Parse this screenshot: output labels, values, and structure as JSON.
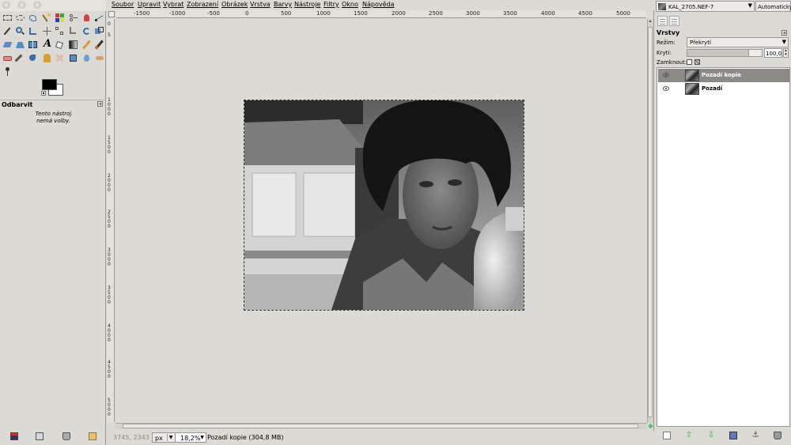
{
  "toolbox": {
    "tool_options_title": "Odbarvit",
    "tool_options_note": "Tento nástroj\nnemá volby.",
    "foreground_color": "#000000",
    "background_color": "#ffffff"
  },
  "menu": {
    "items": [
      "Soubor",
      "Upravit",
      "Vybrat",
      "Zobrazení",
      "Obrázek",
      "Vrstva",
      "Barvy",
      "Nástroje",
      "Filtry",
      "Okno",
      "Nápověda"
    ]
  },
  "ruler": {
    "h_labels": [
      "-1500",
      "-1000",
      "-500",
      "0",
      "500",
      "1000",
      "1500",
      "2000",
      "2500",
      "3000",
      "3500",
      "4000",
      "4500",
      "5000"
    ],
    "v_labels": [
      "0",
      "5",
      "1000",
      "1500",
      "2000",
      "2500",
      "3000",
      "3500",
      "4000",
      "4500",
      "5000"
    ]
  },
  "status": {
    "pointer_coords": "3745, 2343",
    "unit": "px",
    "zoom": "18,2%",
    "text": "Pozadí kopie (304,8 MB)"
  },
  "dock": {
    "image_name": "KAL_2705.NEF-7",
    "auto_label": "Automaticky",
    "layers_title": "Vrstvy",
    "mode_label": "Režim:",
    "mode_value": "Překrytí",
    "opacity_label": "Krytí:",
    "opacity_value": "100,0",
    "lock_label": "Zamknout:",
    "layers": [
      {
        "name": "Pozadí kopie",
        "selected": true
      },
      {
        "name": "Pozadí",
        "selected": false
      }
    ]
  },
  "colors": {
    "window_bg": "#dcdad5",
    "selected_layer": "#8c8a86"
  }
}
